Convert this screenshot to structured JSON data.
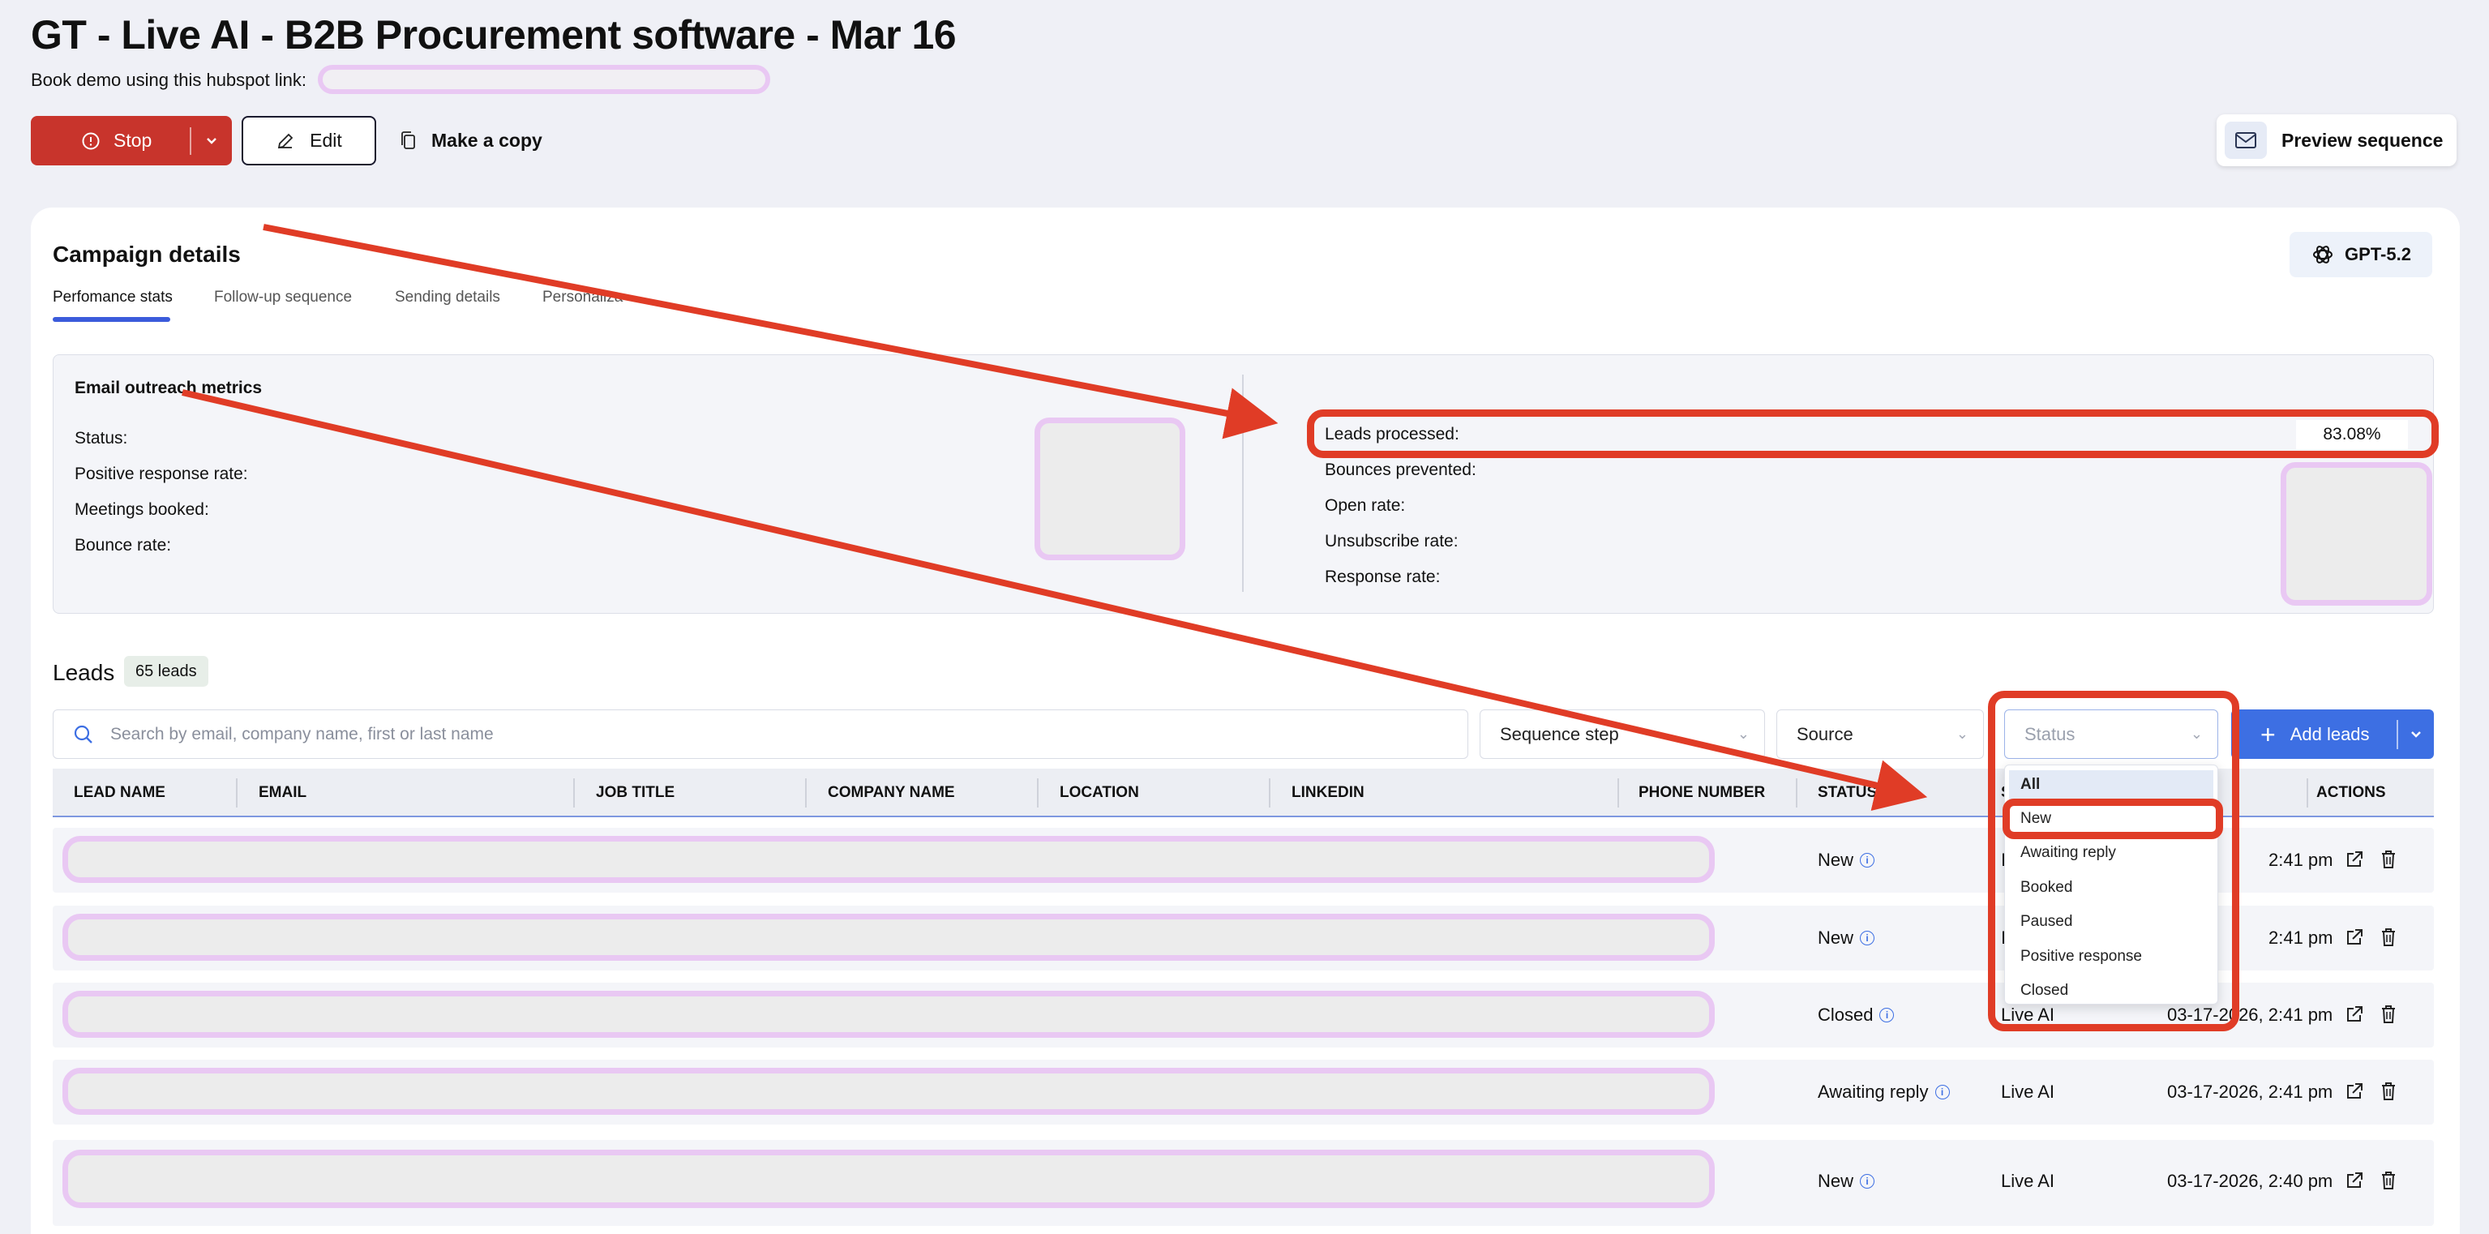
{
  "header": {
    "title": "GT - Live AI - B2B Procurement software - Mar 16",
    "subline": "Book demo using this hubspot link:"
  },
  "toolbar": {
    "stop_label": "Stop",
    "edit_label": "Edit",
    "copy_label": "Make a copy",
    "preview_label": "Preview sequence"
  },
  "campaign": {
    "title": "Campaign details",
    "model": "GPT-5.2",
    "tabs": [
      "Perfomance stats",
      "Follow-up sequence",
      "Sending details",
      "Personaliza"
    ]
  },
  "metrics": {
    "title": "Email outreach metrics",
    "left": [
      "Status:",
      "Positive response rate:",
      "Meetings booked:",
      "Bounce rate:"
    ],
    "right": [
      "Leads processed:",
      "Bounces prevented:",
      "Open rate:",
      "Unsubscribe rate:",
      "Response rate:"
    ],
    "leads_processed_value": "83.08%"
  },
  "leads": {
    "title": "Leads",
    "count_badge": "65 leads",
    "search_placeholder": "Search by email, company name, first or last name",
    "filters": {
      "sequence_step": "Sequence step",
      "source": "Source",
      "status": "Status"
    },
    "add_label": "Add leads",
    "columns": [
      "LEAD NAME",
      "EMAIL",
      "JOB TITLE",
      "COMPANY NAME",
      "LOCATION",
      "LINKEDIN",
      "PHONE NUMBER",
      "STATUS",
      "S",
      "ACTIONS"
    ],
    "rows": [
      {
        "status": "New",
        "source": "I",
        "time": "2:41 pm"
      },
      {
        "status": "New",
        "source": "I",
        "time": "2:41 pm"
      },
      {
        "status": "Closed",
        "source": "Live AI",
        "time": "03-17-2026, 2:41 pm"
      },
      {
        "status": "Awaiting reply",
        "source": "Live AI",
        "time": "03-17-2026, 2:41 pm"
      },
      {
        "status": "New",
        "source": "Live AI",
        "time": "03-17-2026, 2:40 pm"
      }
    ]
  },
  "status_dropdown": {
    "options": [
      "All",
      "New",
      "Awaiting reply",
      "Booked",
      "Paused",
      "Positive response",
      "Closed"
    ]
  },
  "colors": {
    "stop": "#c8342c",
    "accent": "#3d6fe3",
    "annotation": "#e03c26",
    "redaction": "#e9c8f3"
  }
}
